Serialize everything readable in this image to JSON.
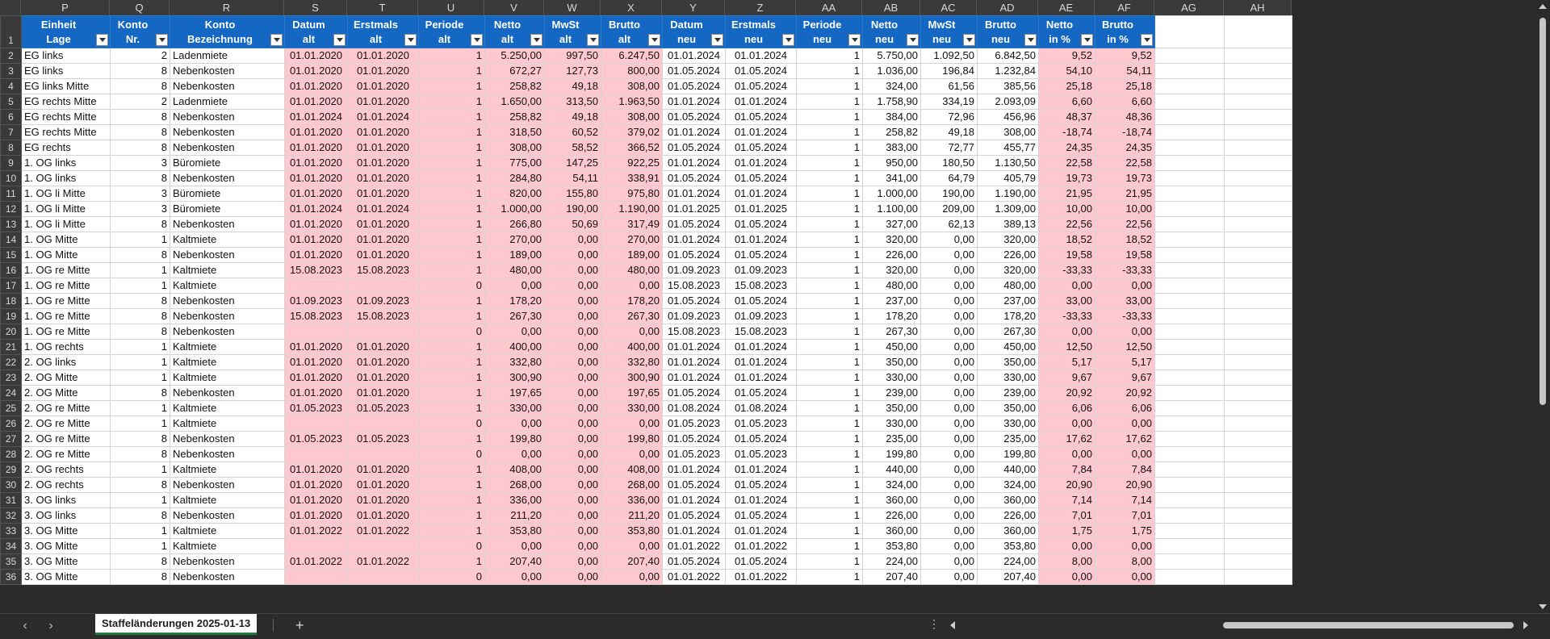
{
  "columns": [
    "P",
    "Q",
    "R",
    "S",
    "T",
    "U",
    "V",
    "W",
    "X",
    "Y",
    "Z",
    "AA",
    "AB",
    "AC",
    "AD",
    "AE",
    "AF",
    "AG",
    "AH"
  ],
  "headers": [
    [
      "Einheit",
      "Lage"
    ],
    [
      "Konto",
      "Nr."
    ],
    [
      "Konto",
      "Bezeichnung"
    ],
    [
      "Datum",
      "alt"
    ],
    [
      "Erstmals",
      "alt"
    ],
    [
      "Periode",
      "alt"
    ],
    [
      "Netto",
      "alt"
    ],
    [
      "MwSt",
      "alt"
    ],
    [
      "Brutto",
      "alt"
    ],
    [
      "Datum",
      "neu"
    ],
    [
      "Erstmals",
      "neu"
    ],
    [
      "Periode",
      "neu"
    ],
    [
      "Netto",
      "neu"
    ],
    [
      "MwSt",
      "neu"
    ],
    [
      "Brutto",
      "neu"
    ],
    [
      "Netto",
      "in %"
    ],
    [
      "Brutto",
      "in %"
    ]
  ],
  "rows": [
    [
      "EG links",
      "2",
      "Ladenmiete",
      "01.01.2020",
      "01.01.2020",
      "1",
      "5.250,00",
      "997,50",
      "6.247,50",
      "01.01.2024",
      "01.01.2024",
      "1",
      "5.750,00",
      "1.092,50",
      "6.842,50",
      "9,52",
      "9,52"
    ],
    [
      "EG links",
      "8",
      "Nebenkosten",
      "01.01.2020",
      "01.01.2020",
      "1",
      "672,27",
      "127,73",
      "800,00",
      "01.05.2024",
      "01.05.2024",
      "1",
      "1.036,00",
      "196,84",
      "1.232,84",
      "54,10",
      "54,11"
    ],
    [
      "EG links Mitte",
      "8",
      "Nebenkosten",
      "01.01.2020",
      "01.01.2020",
      "1",
      "258,82",
      "49,18",
      "308,00",
      "01.05.2024",
      "01.05.2024",
      "1",
      "324,00",
      "61,56",
      "385,56",
      "25,18",
      "25,18"
    ],
    [
      "EG rechts Mitte",
      "2",
      "Ladenmiete",
      "01.01.2020",
      "01.01.2020",
      "1",
      "1.650,00",
      "313,50",
      "1.963,50",
      "01.01.2024",
      "01.01.2024",
      "1",
      "1.758,90",
      "334,19",
      "2.093,09",
      "6,60",
      "6,60"
    ],
    [
      "EG rechts Mitte",
      "8",
      "Nebenkosten",
      "01.01.2024",
      "01.01.2024",
      "1",
      "258,82",
      "49,18",
      "308,00",
      "01.05.2024",
      "01.05.2024",
      "1",
      "384,00",
      "72,96",
      "456,96",
      "48,37",
      "48,36"
    ],
    [
      "EG rechts Mitte",
      "8",
      "Nebenkosten",
      "01.01.2020",
      "01.01.2020",
      "1",
      "318,50",
      "60,52",
      "379,02",
      "01.01.2024",
      "01.01.2024",
      "1",
      "258,82",
      "49,18",
      "308,00",
      "-18,74",
      "-18,74"
    ],
    [
      "EG rechts",
      "8",
      "Nebenkosten",
      "01.01.2020",
      "01.01.2020",
      "1",
      "308,00",
      "58,52",
      "366,52",
      "01.05.2024",
      "01.05.2024",
      "1",
      "383,00",
      "72,77",
      "455,77",
      "24,35",
      "24,35"
    ],
    [
      "1. OG links",
      "3",
      "Büromiete",
      "01.01.2020",
      "01.01.2020",
      "1",
      "775,00",
      "147,25",
      "922,25",
      "01.01.2024",
      "01.01.2024",
      "1",
      "950,00",
      "180,50",
      "1.130,50",
      "22,58",
      "22,58"
    ],
    [
      "1. OG links",
      "8",
      "Nebenkosten",
      "01.01.2020",
      "01.01.2020",
      "1",
      "284,80",
      "54,11",
      "338,91",
      "01.05.2024",
      "01.05.2024",
      "1",
      "341,00",
      "64,79",
      "405,79",
      "19,73",
      "19,73"
    ],
    [
      "1. OG li Mitte",
      "3",
      "Büromiete",
      "01.01.2020",
      "01.01.2020",
      "1",
      "820,00",
      "155,80",
      "975,80",
      "01.01.2024",
      "01.01.2024",
      "1",
      "1.000,00",
      "190,00",
      "1.190,00",
      "21,95",
      "21,95"
    ],
    [
      "1. OG li Mitte",
      "3",
      "Büromiete",
      "01.01.2024",
      "01.01.2024",
      "1",
      "1.000,00",
      "190,00",
      "1.190,00",
      "01.01.2025",
      "01.01.2025",
      "1",
      "1.100,00",
      "209,00",
      "1.309,00",
      "10,00",
      "10,00"
    ],
    [
      "1. OG li Mitte",
      "8",
      "Nebenkosten",
      "01.01.2020",
      "01.01.2020",
      "1",
      "266,80",
      "50,69",
      "317,49",
      "01.05.2024",
      "01.05.2024",
      "1",
      "327,00",
      "62,13",
      "389,13",
      "22,56",
      "22,56"
    ],
    [
      "1. OG Mitte",
      "1",
      "Kaltmiete",
      "01.01.2020",
      "01.01.2020",
      "1",
      "270,00",
      "0,00",
      "270,00",
      "01.01.2024",
      "01.01.2024",
      "1",
      "320,00",
      "0,00",
      "320,00",
      "18,52",
      "18,52"
    ],
    [
      "1. OG Mitte",
      "8",
      "Nebenkosten",
      "01.01.2020",
      "01.01.2020",
      "1",
      "189,00",
      "0,00",
      "189,00",
      "01.05.2024",
      "01.05.2024",
      "1",
      "226,00",
      "0,00",
      "226,00",
      "19,58",
      "19,58"
    ],
    [
      "1. OG re Mitte",
      "1",
      "Kaltmiete",
      "15.08.2023",
      "15.08.2023",
      "1",
      "480,00",
      "0,00",
      "480,00",
      "01.09.2023",
      "01.09.2023",
      "1",
      "320,00",
      "0,00",
      "320,00",
      "-33,33",
      "-33,33"
    ],
    [
      "1. OG re Mitte",
      "1",
      "Kaltmiete",
      "",
      "",
      "0",
      "0,00",
      "0,00",
      "0,00",
      "15.08.2023",
      "15.08.2023",
      "1",
      "480,00",
      "0,00",
      "480,00",
      "0,00",
      "0,00"
    ],
    [
      "1. OG re Mitte",
      "8",
      "Nebenkosten",
      "01.09.2023",
      "01.09.2023",
      "1",
      "178,20",
      "0,00",
      "178,20",
      "01.05.2024",
      "01.05.2024",
      "1",
      "237,00",
      "0,00",
      "237,00",
      "33,00",
      "33,00"
    ],
    [
      "1. OG re Mitte",
      "8",
      "Nebenkosten",
      "15.08.2023",
      "15.08.2023",
      "1",
      "267,30",
      "0,00",
      "267,30",
      "01.09.2023",
      "01.09.2023",
      "1",
      "178,20",
      "0,00",
      "178,20",
      "-33,33",
      "-33,33"
    ],
    [
      "1. OG re Mitte",
      "8",
      "Nebenkosten",
      "",
      "",
      "0",
      "0,00",
      "0,00",
      "0,00",
      "15.08.2023",
      "15.08.2023",
      "1",
      "267,30",
      "0,00",
      "267,30",
      "0,00",
      "0,00"
    ],
    [
      "1. OG rechts",
      "1",
      "Kaltmiete",
      "01.01.2020",
      "01.01.2020",
      "1",
      "400,00",
      "0,00",
      "400,00",
      "01.01.2024",
      "01.01.2024",
      "1",
      "450,00",
      "0,00",
      "450,00",
      "12,50",
      "12,50"
    ],
    [
      "2. OG links",
      "1",
      "Kaltmiete",
      "01.01.2020",
      "01.01.2020",
      "1",
      "332,80",
      "0,00",
      "332,80",
      "01.01.2024",
      "01.01.2024",
      "1",
      "350,00",
      "0,00",
      "350,00",
      "5,17",
      "5,17"
    ],
    [
      "2. OG Mitte",
      "1",
      "Kaltmiete",
      "01.01.2020",
      "01.01.2020",
      "1",
      "300,90",
      "0,00",
      "300,90",
      "01.01.2024",
      "01.01.2024",
      "1",
      "330,00",
      "0,00",
      "330,00",
      "9,67",
      "9,67"
    ],
    [
      "2. OG Mitte",
      "8",
      "Nebenkosten",
      "01.01.2020",
      "01.01.2020",
      "1",
      "197,65",
      "0,00",
      "197,65",
      "01.05.2024",
      "01.05.2024",
      "1",
      "239,00",
      "0,00",
      "239,00",
      "20,92",
      "20,92"
    ],
    [
      "2. OG re Mitte",
      "1",
      "Kaltmiete",
      "01.05.2023",
      "01.05.2023",
      "1",
      "330,00",
      "0,00",
      "330,00",
      "01.08.2024",
      "01.08.2024",
      "1",
      "350,00",
      "0,00",
      "350,00",
      "6,06",
      "6,06"
    ],
    [
      "2. OG re Mitte",
      "1",
      "Kaltmiete",
      "",
      "",
      "0",
      "0,00",
      "0,00",
      "0,00",
      "01.05.2023",
      "01.05.2023",
      "1",
      "330,00",
      "0,00",
      "330,00",
      "0,00",
      "0,00"
    ],
    [
      "2. OG re Mitte",
      "8",
      "Nebenkosten",
      "01.05.2023",
      "01.05.2023",
      "1",
      "199,80",
      "0,00",
      "199,80",
      "01.05.2024",
      "01.05.2024",
      "1",
      "235,00",
      "0,00",
      "235,00",
      "17,62",
      "17,62"
    ],
    [
      "2. OG re Mitte",
      "8",
      "Nebenkosten",
      "",
      "",
      "0",
      "0,00",
      "0,00",
      "0,00",
      "01.05.2023",
      "01.05.2023",
      "1",
      "199,80",
      "0,00",
      "199,80",
      "0,00",
      "0,00"
    ],
    [
      "2. OG rechts",
      "1",
      "Kaltmiete",
      "01.01.2020",
      "01.01.2020",
      "1",
      "408,00",
      "0,00",
      "408,00",
      "01.01.2024",
      "01.01.2024",
      "1",
      "440,00",
      "0,00",
      "440,00",
      "7,84",
      "7,84"
    ],
    [
      "2. OG rechts",
      "8",
      "Nebenkosten",
      "01.01.2020",
      "01.01.2020",
      "1",
      "268,00",
      "0,00",
      "268,00",
      "01.05.2024",
      "01.05.2024",
      "1",
      "324,00",
      "0,00",
      "324,00",
      "20,90",
      "20,90"
    ],
    [
      "3. OG links",
      "1",
      "Kaltmiete",
      "01.01.2020",
      "01.01.2020",
      "1",
      "336,00",
      "0,00",
      "336,00",
      "01.01.2024",
      "01.01.2024",
      "1",
      "360,00",
      "0,00",
      "360,00",
      "7,14",
      "7,14"
    ],
    [
      "3. OG links",
      "8",
      "Nebenkosten",
      "01.01.2020",
      "01.01.2020",
      "1",
      "211,20",
      "0,00",
      "211,20",
      "01.05.2024",
      "01.05.2024",
      "1",
      "226,00",
      "0,00",
      "226,00",
      "7,01",
      "7,01"
    ],
    [
      "3. OG Mitte",
      "1",
      "Kaltmiete",
      "01.01.2022",
      "01.01.2022",
      "1",
      "353,80",
      "0,00",
      "353,80",
      "01.01.2024",
      "01.01.2024",
      "1",
      "360,00",
      "0,00",
      "360,00",
      "1,75",
      "1,75"
    ],
    [
      "3. OG Mitte",
      "1",
      "Kaltmiete",
      "",
      "",
      "0",
      "0,00",
      "0,00",
      "0,00",
      "01.01.2022",
      "01.01.2022",
      "1",
      "353,80",
      "0,00",
      "353,80",
      "0,00",
      "0,00"
    ],
    [
      "3. OG Mitte",
      "8",
      "Nebenkosten",
      "01.01.2022",
      "01.01.2022",
      "1",
      "207,40",
      "0,00",
      "207,40",
      "01.05.2024",
      "01.05.2024",
      "1",
      "224,00",
      "0,00",
      "224,00",
      "8,00",
      "8,00"
    ],
    [
      "3. OG Mitte",
      "8",
      "Nebenkosten",
      "",
      "",
      "0",
      "0,00",
      "0,00",
      "0,00",
      "01.01.2022",
      "01.01.2022",
      "1",
      "207,40",
      "0,00",
      "207,40",
      "0,00",
      "0,00"
    ]
  ],
  "sheet_tab": "Staffeländerungen 2025-01-13",
  "add_sheet": "+",
  "nav_prev": "‹",
  "nav_next": "›",
  "more": "⋮",
  "colors": {
    "header_blue": "#1467c2",
    "pink": "#ffc7ce",
    "tab_underline": "#1f7a3f"
  }
}
